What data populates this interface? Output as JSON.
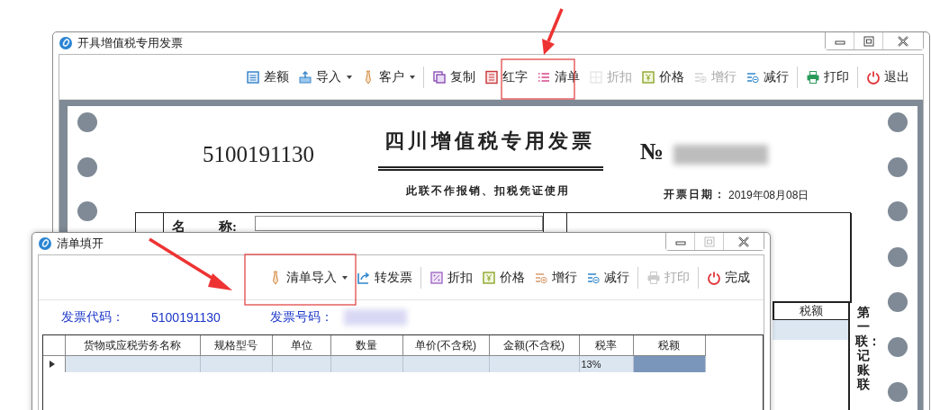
{
  "main_window": {
    "title": "开具增值税专用发票",
    "toolbar": [
      {
        "kind": "button",
        "label": "差额",
        "dropdown": false,
        "disabled": false
      },
      {
        "kind": "button",
        "label": "导入",
        "dropdown": true,
        "disabled": false
      },
      {
        "kind": "button",
        "label": "客户",
        "dropdown": true,
        "disabled": false
      },
      {
        "kind": "separator"
      },
      {
        "kind": "button",
        "label": "复制",
        "dropdown": false,
        "disabled": false
      },
      {
        "kind": "button",
        "label": "红字",
        "dropdown": false,
        "disabled": false
      },
      {
        "kind": "button",
        "label": "清单",
        "dropdown": false,
        "disabled": false
      },
      {
        "kind": "button",
        "label": "折扣",
        "dropdown": false,
        "disabled": true
      },
      {
        "kind": "button",
        "label": "价格",
        "dropdown": false,
        "disabled": false
      },
      {
        "kind": "button",
        "label": "增行",
        "dropdown": false,
        "disabled": true
      },
      {
        "kind": "button",
        "label": "减行",
        "dropdown": false,
        "disabled": false
      },
      {
        "kind": "separator"
      },
      {
        "kind": "button",
        "label": "打印",
        "dropdown": false,
        "disabled": false
      },
      {
        "kind": "separator"
      },
      {
        "kind": "button",
        "label": "退出",
        "dropdown": false,
        "disabled": false
      }
    ],
    "invoice": {
      "code": "5100191130",
      "title": "四川增值税专用发票",
      "notice": "此联不作报销、扣税凭证使用",
      "number_sign": "№",
      "date_label": "开票日期：",
      "date": "2019年08月08日",
      "name_label_1": "名",
      "name_label_2": "称:",
      "tax_header": "税额",
      "copy_label": "第一联：记账联"
    }
  },
  "dialog": {
    "title": "清单填开",
    "toolbar": [
      {
        "kind": "button",
        "label": "清单导入",
        "dropdown": true,
        "disabled": false
      },
      {
        "kind": "button",
        "label": "转发票",
        "dropdown": false,
        "disabled": false
      },
      {
        "kind": "separator"
      },
      {
        "kind": "button",
        "label": "折扣",
        "dropdown": false,
        "disabled": false
      },
      {
        "kind": "button",
        "label": "价格",
        "dropdown": false,
        "disabled": false
      },
      {
        "kind": "button",
        "label": "增行",
        "dropdown": false,
        "disabled": false
      },
      {
        "kind": "button",
        "label": "减行",
        "dropdown": false,
        "disabled": false
      },
      {
        "kind": "separator"
      },
      {
        "kind": "button",
        "label": "打印",
        "dropdown": false,
        "disabled": true
      },
      {
        "kind": "separator"
      },
      {
        "kind": "button",
        "label": "完成",
        "dropdown": false,
        "disabled": false
      }
    ],
    "code_label": "发票代码：",
    "code": "5100191130",
    "number_label": "发票号码：",
    "table": {
      "columns": [
        "货物或应税劳务名称",
        "规格型号",
        "单位",
        "数量",
        "单价(不含税)",
        "金额(不含税)",
        "税率",
        "税额"
      ],
      "rows": [
        {
          "current": true,
          "cells": [
            {
              "selected": false
            },
            {
              "selected": false
            },
            {
              "selected": false
            },
            {
              "selected": false
            },
            {
              "selected": false
            },
            {
              "selected": false
            },
            {
              "text": "13%",
              "selected": false
            },
            {
              "selected": true
            }
          ]
        }
      ]
    }
  }
}
